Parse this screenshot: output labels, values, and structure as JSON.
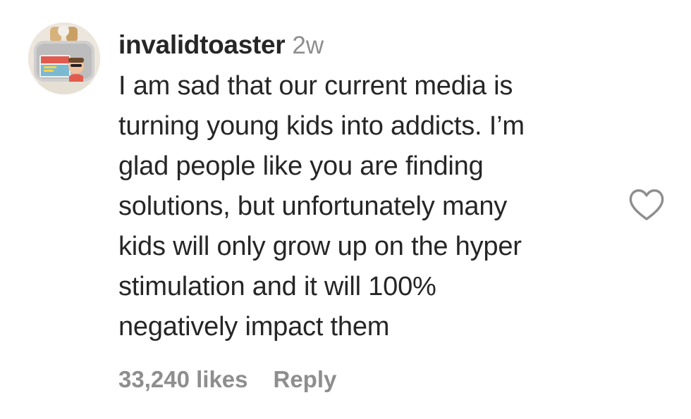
{
  "comment": {
    "username": "invalidtoaster",
    "timestamp": "2w",
    "body_lines": [
      "I am sad that our current media is",
      "turning young kids into addicts. I’m",
      "glad people like you are finding",
      "solutions, but unfortunately many",
      "kids will only grow up on the hyper",
      "stimulation and it will 100%",
      "negatively impact them"
    ],
    "likes": "33,240 likes",
    "reply_label": "Reply",
    "like_icon": "heart-outline-icon",
    "avatar_icon": "toaster-avatar-image"
  },
  "colors": {
    "text_primary": "#262626",
    "text_secondary": "#8e8e8e",
    "background": "#ffffff"
  }
}
